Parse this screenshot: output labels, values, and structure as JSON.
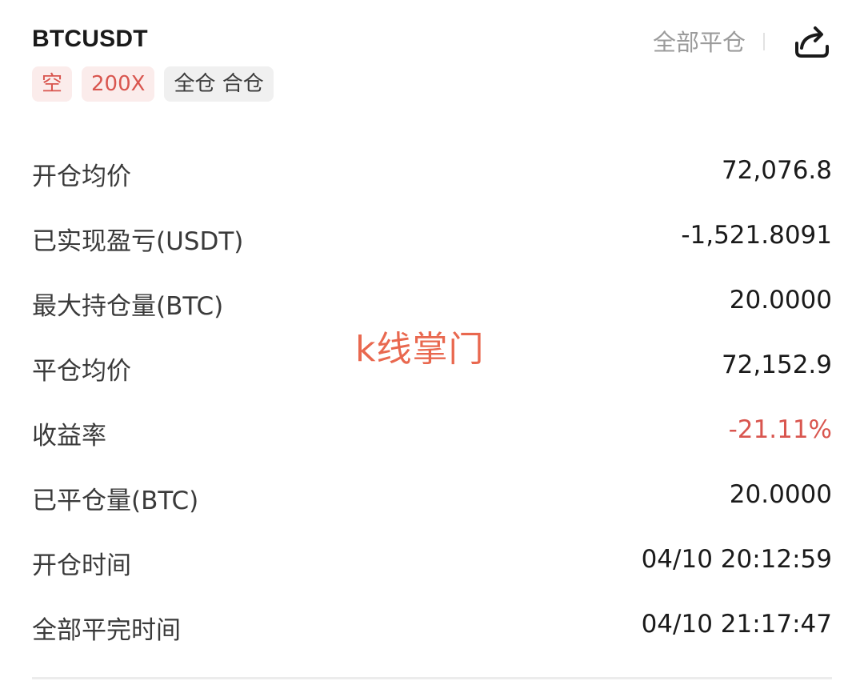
{
  "header": {
    "symbol": "BTCUSDT",
    "close_all_label": "全部平仓",
    "share_icon": "share-icon"
  },
  "tags": [
    {
      "label": "空"
    },
    {
      "label": "200X"
    },
    {
      "label": "全仓 合仓"
    }
  ],
  "details": [
    {
      "label": "开仓均价",
      "value": "72,076.8"
    },
    {
      "label": "已实现盈亏(USDT)",
      "value": "-1,521.8091"
    },
    {
      "label": "最大持仓量(BTC)",
      "value": "20.0000"
    },
    {
      "label": "平仓均价",
      "value": "72,152.9"
    },
    {
      "label": "收益率",
      "value": "-21.11%"
    },
    {
      "label": "已平仓量(BTC)",
      "value": "20.0000"
    },
    {
      "label": "开仓时间",
      "value": "04/10 20:12:59"
    },
    {
      "label": "全部平完时间",
      "value": "04/10 21:17:47"
    }
  ],
  "watermark": "k线掌门",
  "colors": {
    "negative": "#d9564f",
    "muted": "#9b9b9b",
    "watermark": "#e9684f"
  }
}
